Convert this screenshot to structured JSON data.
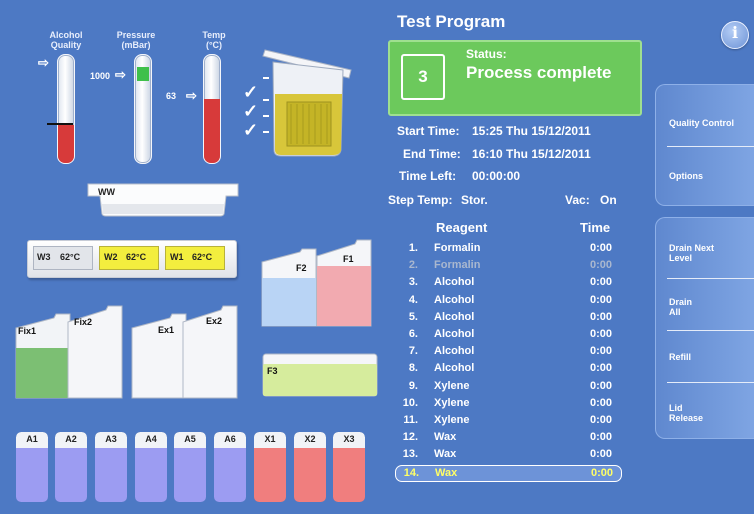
{
  "gauges": {
    "alcohol_label": "Alcohol Quality",
    "pressure_label": "Pressure (mBar)",
    "pressure_value": "1000",
    "temp_label": "Temp (°C)",
    "temp_value": "63"
  },
  "baths": {
    "ww_label": "WW",
    "w3_name": "W3",
    "w3_temp": "62°C",
    "w2_name": "W2",
    "w2_temp": "62°C",
    "w1_name": "W1",
    "w1_temp": "62°C"
  },
  "bottles": {
    "fix1": "Fix1",
    "fix2": "Fix2",
    "ex1": "Ex1",
    "ex2": "Ex2",
    "f1": "F1",
    "f2": "F2",
    "f3": "F3",
    "small": [
      "A1",
      "A2",
      "A3",
      "A4",
      "A5",
      "A6",
      "X1",
      "X2",
      "X3"
    ]
  },
  "program": {
    "title": "Test Program",
    "step_number": "3",
    "status_label": "Status:",
    "status_value": "Process complete",
    "start_label": "Start Time:",
    "start_value": "15:25 Thu 15/12/2011",
    "end_label": "End Time:",
    "end_value": "16:10 Thu 15/12/2011",
    "left_label": "Time Left:",
    "left_value": "00:00:00",
    "step_temp_label": "Step Temp:",
    "step_temp_value": "Stor.",
    "vac_label": "Vac:",
    "vac_value": "On"
  },
  "reagents": {
    "col_reagent": "Reagent",
    "col_time": "Time",
    "rows": [
      {
        "num": "1.",
        "name": "Formalin",
        "time": "0:00"
      },
      {
        "num": "2.",
        "name": "Formalin",
        "time": "0:00"
      },
      {
        "num": "3.",
        "name": "Alcohol",
        "time": "0:00"
      },
      {
        "num": "4.",
        "name": "Alcohol",
        "time": "0:00"
      },
      {
        "num": "5.",
        "name": "Alcohol",
        "time": "0:00"
      },
      {
        "num": "6.",
        "name": "Alcohol",
        "time": "0:00"
      },
      {
        "num": "7.",
        "name": "Alcohol",
        "time": "0:00"
      },
      {
        "num": "8.",
        "name": "Alcohol",
        "time": "0:00"
      },
      {
        "num": "9.",
        "name": "Xylene",
        "time": "0:00"
      },
      {
        "num": "10.",
        "name": "Xylene",
        "time": "0:00"
      },
      {
        "num": "11.",
        "name": "Xylene",
        "time": "0:00"
      },
      {
        "num": "12.",
        "name": "Wax",
        "time": "0:00"
      },
      {
        "num": "13.",
        "name": "Wax",
        "time": "0:00"
      },
      {
        "num": "14.",
        "name": "Wax",
        "time": "0:00"
      }
    ]
  },
  "side": {
    "info_icon": "i",
    "quality_control": "Quality Control",
    "options": "Options",
    "drain_next": "Drain Next Level",
    "drain_all": "Drain All",
    "refill": "Refill",
    "lid_release": "Lid Release"
  },
  "colors": {
    "background": "#4d79c4",
    "status_green": "#6cc95c",
    "highlight_yellow": "#ffff66",
    "disabled_text": "#a9b7cf"
  }
}
